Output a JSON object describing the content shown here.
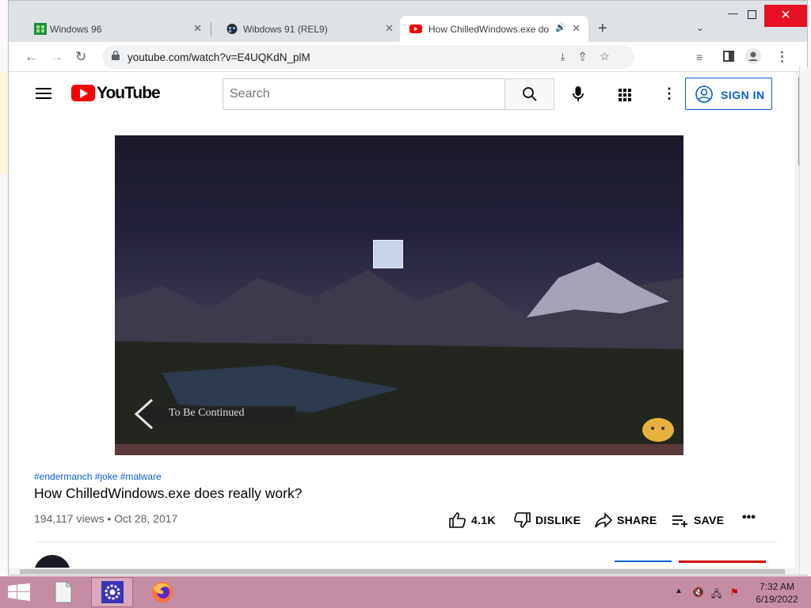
{
  "browser": {
    "tabs": [
      {
        "title": "Windows 96",
        "active": false
      },
      {
        "title": "Wibdows 91 (REL9)",
        "active": false
      },
      {
        "title": "How ChilledWindows.exe do",
        "active": true
      }
    ],
    "url": "youtube.com/watch?v=E4UQKdN_plM",
    "accent": "#1a73e8"
  },
  "youtube": {
    "logo_text": "YouTube",
    "search_placeholder": "Search",
    "sign_in_label": "SIGN IN",
    "video": {
      "banner_text": "To Be Continued",
      "hashtags": "#endermanch #joke #malware",
      "title": "How ChilledWindows.exe does really work?",
      "views_date": "194,117 views • Oct 28, 2017",
      "actions": {
        "like": "4.1K",
        "dislike": "DISLIKE",
        "share": "SHARE",
        "save": "SAVE"
      }
    }
  },
  "taskbar": {
    "time": "7:32 AM",
    "date": "6/19/2022",
    "color": "#c58da4"
  }
}
